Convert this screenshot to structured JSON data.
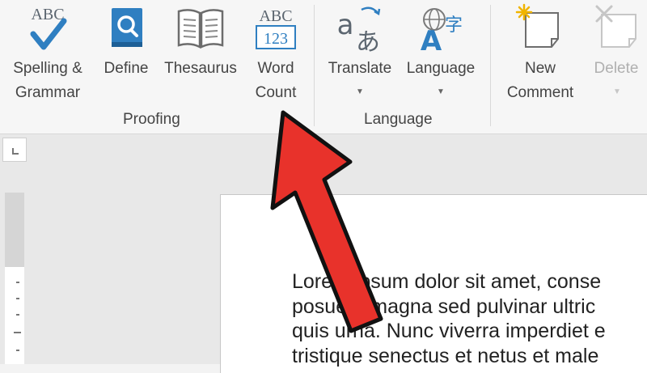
{
  "ribbon": {
    "proofing": {
      "group_label": "Proofing",
      "spelling": {
        "icon_text": "ABC",
        "label_line1": "Spelling &",
        "label_line2": "Grammar"
      },
      "define": {
        "label": "Define"
      },
      "thesaurus": {
        "label": "Thesaurus"
      },
      "word_count": {
        "icon_top": "ABC",
        "icon_bottom": "123",
        "label_line1": "Word",
        "label_line2": "Count"
      }
    },
    "language": {
      "group_label": "Language",
      "translate": {
        "label": "Translate"
      },
      "language": {
        "label": "Language"
      }
    },
    "comments": {
      "new_comment": {
        "label_line1": "New",
        "label_line2": "Comment"
      },
      "delete": {
        "label": "Delete"
      }
    }
  },
  "document": {
    "lines": [
      "Lorem ipsum dolor sit amet, conse",
      "posuere magna sed pulvinar ultric",
      "quis urna. Nunc viverra imperdiet e",
      "tristique senectus et netus et male"
    ]
  },
  "colors": {
    "accent_blue": "#2f7fc1",
    "arrow_red": "#e8322b",
    "ribbon_bg": "#f6f6f6"
  },
  "icons": {
    "spelling": "checkmark-icon",
    "define": "book-search-icon",
    "thesaurus": "open-book-icon",
    "word_count": "abc-123-icon",
    "translate": "translate-icon",
    "language": "globe-language-icon",
    "new_comment": "new-comment-icon",
    "delete": "delete-comment-icon"
  }
}
